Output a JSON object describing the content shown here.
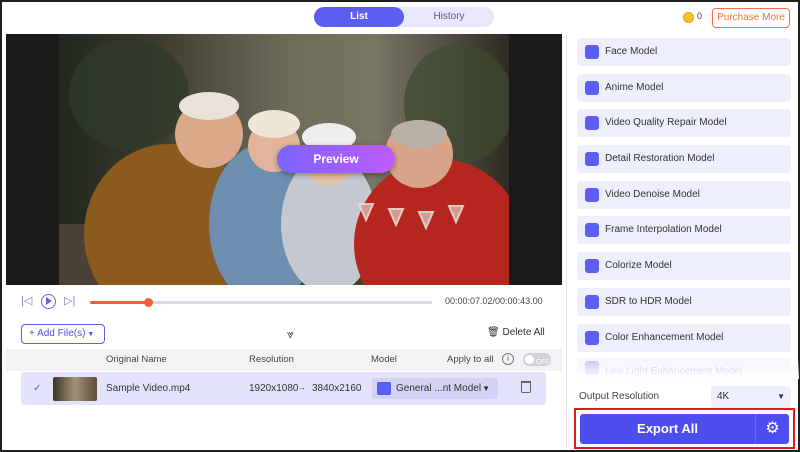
{
  "tabs": {
    "list": "List",
    "history": "History"
  },
  "header": {
    "coin_count": "0",
    "purchase_label": "Purchase More"
  },
  "preview": {
    "button_label": "Preview"
  },
  "player": {
    "time": "00:00:07.02/00:00:43.00",
    "progress_percent": 17
  },
  "toolbar": {
    "add_files_label": "Add File(s)",
    "delete_all_label": "Delete All"
  },
  "file_list": {
    "headers": {
      "original_name": "Original Name",
      "resolution": "Resolution",
      "model": "Model",
      "apply_to_all": "Apply to all",
      "toggle": "OFF"
    },
    "rows": [
      {
        "name": "Sample Video.mp4",
        "res_from": "1920x1080",
        "arrow": "→",
        "res_to": "3840x2160",
        "model": "General ...nt Model"
      }
    ]
  },
  "models": [
    {
      "label": "Face Model",
      "icon": "face-icon"
    },
    {
      "label": "Anime Model",
      "icon": "anime-icon"
    },
    {
      "label": "Video Quality Repair Model",
      "icon": "video-repair-icon"
    },
    {
      "label": "Detail Restoration Model",
      "icon": "detail-restore-icon"
    },
    {
      "label": "Video Denoise Model",
      "icon": "denoise-icon"
    },
    {
      "label": "Frame Interpolation Model",
      "icon": "frame-interp-icon"
    },
    {
      "label": "Colorize Model",
      "icon": "colorize-icon"
    },
    {
      "label": "SDR to HDR Model",
      "icon": "hdr-icon"
    },
    {
      "label": "Color Enhancement Model",
      "icon": "palette-icon"
    },
    {
      "label": "Low Light Enhancement Model",
      "icon": "lowlight-icon"
    }
  ],
  "output": {
    "label": "Output Resolution",
    "value": "4K"
  },
  "export": {
    "label": "Export All"
  },
  "colors": {
    "accent": "#4f4cf0",
    "orange": "#f2603a",
    "highlight": "#e01b1b"
  }
}
